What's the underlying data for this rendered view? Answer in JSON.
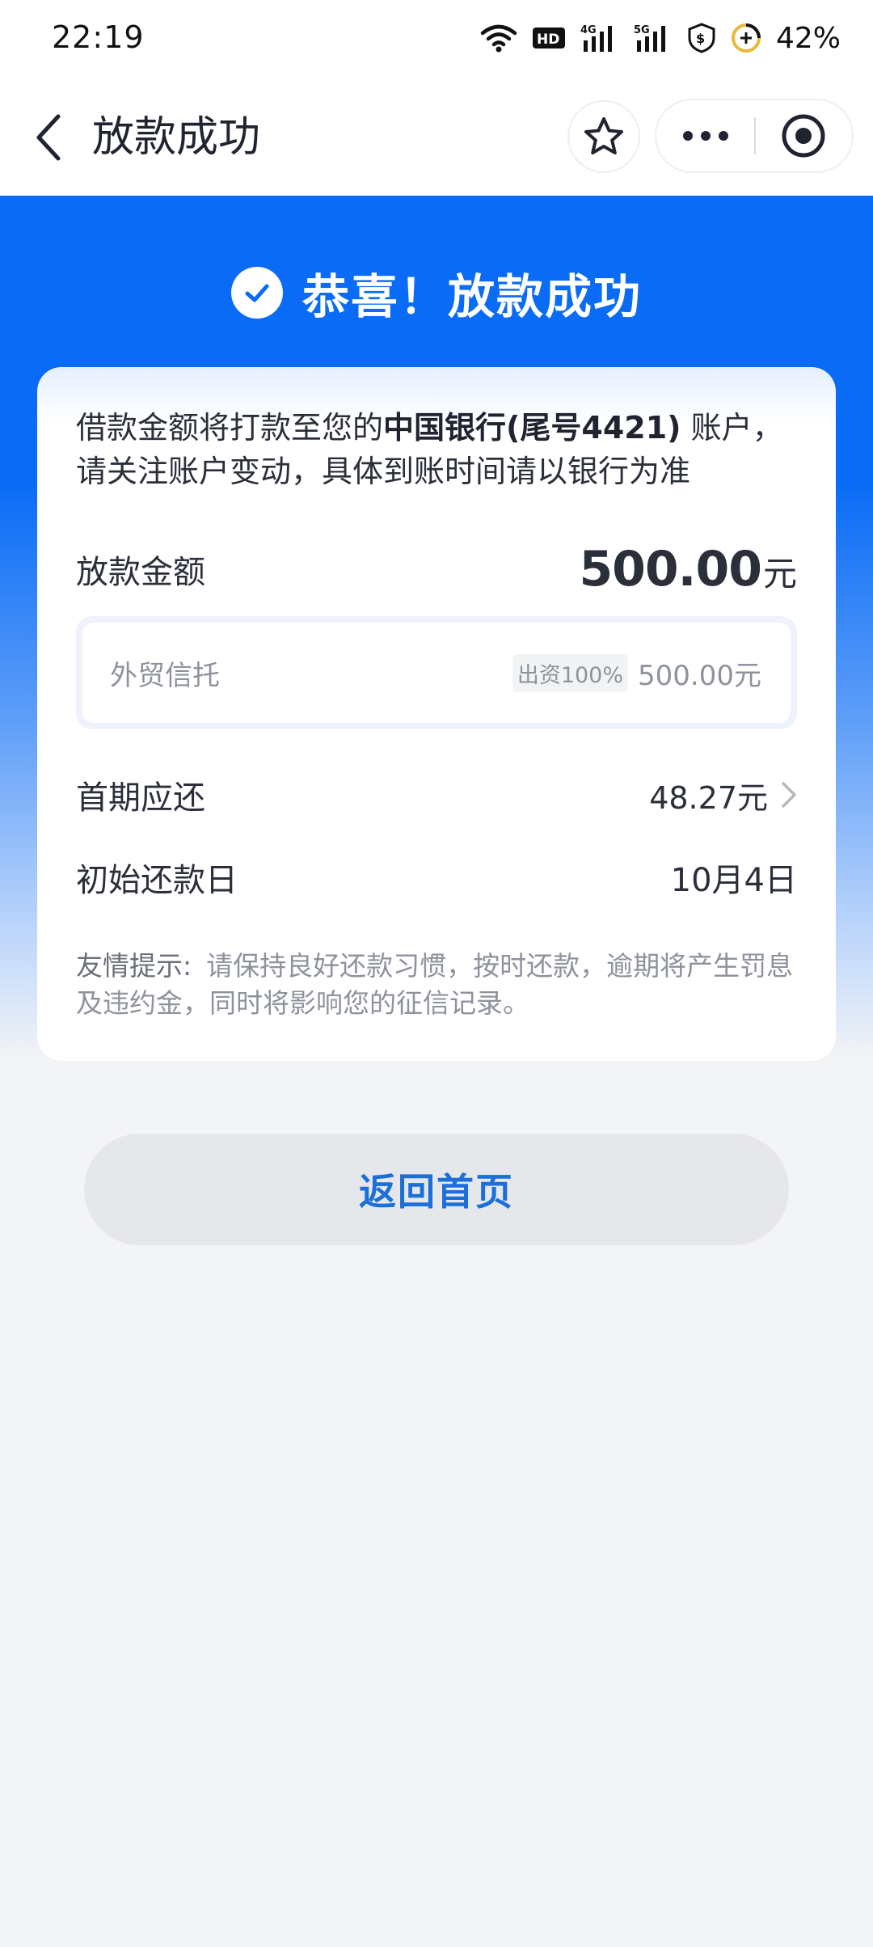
{
  "status_bar": {
    "time": "22:19",
    "battery": "42%",
    "icons": [
      "wifi-icon",
      "hd-icon",
      "signal-4g-icon",
      "signal-5g-icon",
      "shield-dollar-icon",
      "battery-saver-icon"
    ]
  },
  "nav": {
    "title": "放款成功",
    "icons": [
      "back-arrow-icon",
      "star-icon",
      "more-icon",
      "close-target-icon"
    ]
  },
  "hero": {
    "title": "恭喜！放款成功"
  },
  "card": {
    "notice_prefix": "借款金额将打款至您的",
    "notice_bank": "中国银行(尾号4421)",
    "notice_suffix": " 账户，请关注账户变动，具体到账时间请以银行为准",
    "amount_label": "放款金额",
    "amount_value": "500.00",
    "amount_unit": "元",
    "funder": {
      "name": "外贸信托",
      "badge": "出资100%",
      "amount": "500.00元"
    },
    "first_label": "首期应还",
    "first_value": "48.27元",
    "date_label": "初始还款日",
    "date_value": "10月4日",
    "tip_label": "友情提示:",
    "tip_text": "请保持良好还款习惯，按时还款，逾期将产生罚息及违约金，同时将影响您的征信记录。"
  },
  "actions": {
    "home_label": "返回首页"
  },
  "colors": {
    "brand_blue": "#0a6cf6",
    "button_text": "#1a6fd8",
    "page_bg": "#f3f4f6"
  }
}
